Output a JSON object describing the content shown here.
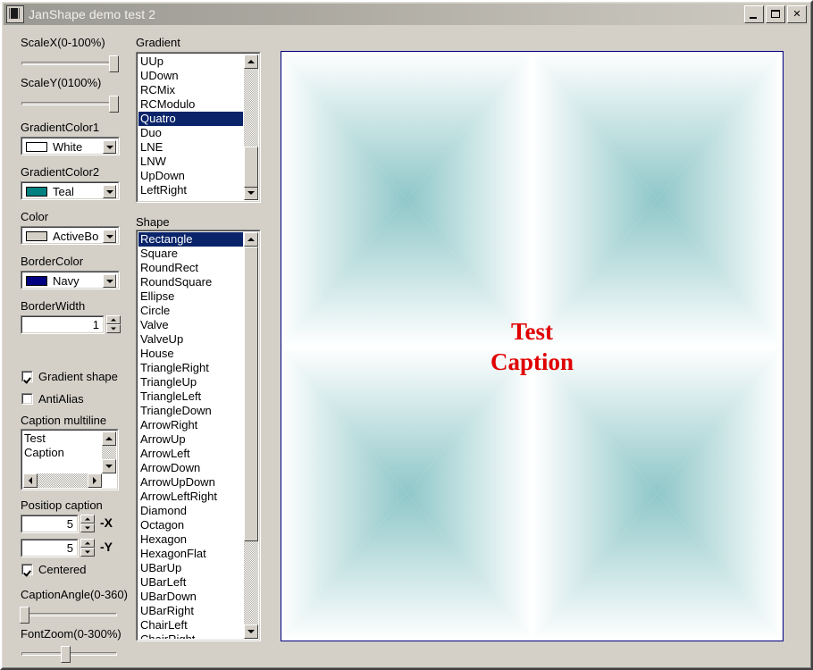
{
  "window": {
    "title": "JanShape demo test 2",
    "icon": "app-icon",
    "buttons": {
      "minimize": "_",
      "maximize": "□",
      "close": "✕"
    }
  },
  "panel": {
    "scale_x": {
      "label": "ScaleX(0-100%)",
      "value": 100,
      "min": 0,
      "max": 100
    },
    "scale_y": {
      "label": "ScaleY(0100%)",
      "value": 100,
      "min": 0,
      "max": 100
    },
    "gradient_color1": {
      "label": "GradientColor1",
      "value": "White",
      "swatch": "#ffffff"
    },
    "gradient_color2": {
      "label": "GradientColor2",
      "value": "Teal",
      "swatch": "#008080"
    },
    "color": {
      "label": "Color",
      "value": "ActiveBo",
      "swatch": "#d4d0c8"
    },
    "border_color": {
      "label": "BorderColor",
      "value": "Navy",
      "swatch": "#000080"
    },
    "border_width": {
      "label": "BorderWidth",
      "value": "1"
    },
    "gradient_shape": {
      "label": "Gradient shape",
      "checked": true
    },
    "anti_alias": {
      "label": "AntiAlias",
      "checked": false
    },
    "caption_multiline": {
      "label": "Caption multiline",
      "value": "Test\nCaption"
    },
    "position_caption": {
      "label": "Positiop caption",
      "x_value": "5",
      "x_suffix": "-X",
      "y_value": "5",
      "y_suffix": "-Y"
    },
    "centered": {
      "label": "Centered",
      "checked": true
    },
    "caption_angle": {
      "label": "CaptionAngle(0-360)",
      "value": 0,
      "min": 0,
      "max": 360
    },
    "font_zoom": {
      "label": "FontZoom(0-300%)",
      "value": 135,
      "min": 0,
      "max": 300
    }
  },
  "gradient_list": {
    "label": "Gradient",
    "selected": "Quatro",
    "items": [
      "UUp",
      "UDown",
      "RCMix",
      "RCModulo",
      "Quatro",
      "Duo",
      "LNE",
      "LNW",
      "UpDown",
      "LeftRight"
    ]
  },
  "shape_list": {
    "label": "Shape",
    "selected": "Rectangle",
    "items": [
      "Rectangle",
      "Square",
      "RoundRect",
      "RoundSquare",
      "Ellipse",
      "Circle",
      "Valve",
      "ValveUp",
      "House",
      "TriangleRight",
      "TriangleUp",
      "TriangleLeft",
      "TriangleDown",
      "ArrowRight",
      "ArrowUp",
      "ArrowLeft",
      "ArrowDown",
      "ArrowUpDown",
      "ArrowLeftRight",
      "Diamond",
      "Octagon",
      "Hexagon",
      "HexagonFlat",
      "UBarUp",
      "UBarLeft",
      "UBarDown",
      "UBarRight",
      "ChairLeft",
      "ChairRight"
    ]
  },
  "preview": {
    "caption": "Test\nCaption",
    "caption_color": "#e00000",
    "border_color": "#000080",
    "gradient_from": "#ffffff",
    "gradient_to": "#1f8f92",
    "gradient_mode": "Quatro",
    "shape": "Rectangle"
  }
}
